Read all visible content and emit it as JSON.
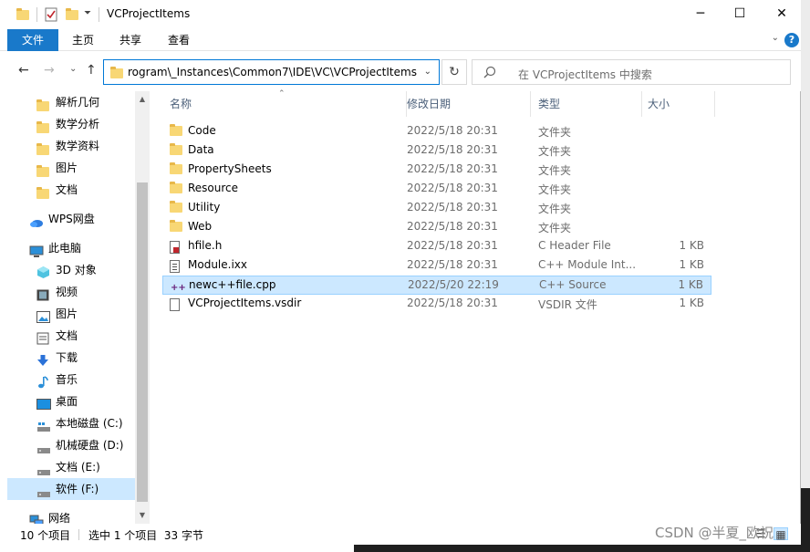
{
  "window": {
    "title": "VCProjectItems",
    "controls": {
      "minimize": "─",
      "maximize": "☐",
      "close": "✕"
    }
  },
  "ribbon": {
    "tabs": [
      "文件",
      "主页",
      "共享",
      "查看"
    ],
    "help": "?",
    "accent_color": "#1979ca"
  },
  "nav": {
    "back": "←",
    "forward": "→",
    "recent": "⌄",
    "up": "↑",
    "address": "rogram\\_Instances\\Common7\\IDE\\VC\\VCProjectItems",
    "refresh": "↻",
    "search_placeholder": "在 VCProjectItems 中搜索"
  },
  "sidebar": {
    "items": [
      {
        "label": "解析几何",
        "icon": "folder-icon",
        "indent": 1
      },
      {
        "label": "数学分析",
        "icon": "folder-icon",
        "indent": 1
      },
      {
        "label": "数学资料",
        "icon": "folder-icon",
        "indent": 1
      },
      {
        "label": "图片",
        "icon": "folder-icon",
        "indent": 1
      },
      {
        "label": "文档",
        "icon": "folder-icon",
        "indent": 1
      },
      {
        "label": "WPS网盘",
        "icon": "cloud-icon",
        "indent": 0
      },
      {
        "label": "此电脑",
        "icon": "computer-icon",
        "indent": 0
      },
      {
        "label": "3D 对象",
        "icon": "cube-icon",
        "indent": 1
      },
      {
        "label": "视频",
        "icon": "video-icon",
        "indent": 1
      },
      {
        "label": "图片",
        "icon": "pictures-icon",
        "indent": 1
      },
      {
        "label": "文档",
        "icon": "documents-icon",
        "indent": 1
      },
      {
        "label": "下载",
        "icon": "download-icon",
        "indent": 1
      },
      {
        "label": "音乐",
        "icon": "music-icon",
        "indent": 1
      },
      {
        "label": "桌面",
        "icon": "desktop-icon",
        "indent": 1
      },
      {
        "label": "本地磁盘 (C:)",
        "icon": "system-drive-icon",
        "indent": 1
      },
      {
        "label": "机械硬盘 (D:)",
        "icon": "drive-icon",
        "indent": 1
      },
      {
        "label": "文档 (E:)",
        "icon": "drive-icon",
        "indent": 1
      },
      {
        "label": "软件 (F:)",
        "icon": "drive-icon",
        "indent": 1,
        "selected": true
      },
      {
        "label": "网络",
        "icon": "network-icon",
        "indent": 0
      }
    ]
  },
  "columns": {
    "name": "名称",
    "date": "修改日期",
    "type": "类型",
    "size": "大小"
  },
  "files": [
    {
      "name": "Code",
      "date": "2022/5/18 20:31",
      "type": "文件夹",
      "size": "",
      "icon": "folder-icon"
    },
    {
      "name": "Data",
      "date": "2022/5/18 20:31",
      "type": "文件夹",
      "size": "",
      "icon": "folder-icon"
    },
    {
      "name": "PropertySheets",
      "date": "2022/5/18 20:31",
      "type": "文件夹",
      "size": "",
      "icon": "folder-icon"
    },
    {
      "name": "Resource",
      "date": "2022/5/18 20:31",
      "type": "文件夹",
      "size": "",
      "icon": "folder-icon"
    },
    {
      "name": "Utility",
      "date": "2022/5/18 20:31",
      "type": "文件夹",
      "size": "",
      "icon": "folder-icon"
    },
    {
      "name": "Web",
      "date": "2022/5/18 20:31",
      "type": "文件夹",
      "size": "",
      "icon": "folder-icon"
    },
    {
      "name": "hfile.h",
      "date": "2022/5/18 20:31",
      "type": "C Header File",
      "size": "1 KB",
      "icon": "header-file-icon"
    },
    {
      "name": "Module.ixx",
      "date": "2022/5/18 20:31",
      "type": "C++ Module Int...",
      "size": "1 KB",
      "icon": "module-file-icon"
    },
    {
      "name": "newc++file.cpp",
      "date": "2022/5/20 22:19",
      "type": "C++ Source",
      "size": "1 KB",
      "icon": "cpp-file-icon",
      "selected": true
    },
    {
      "name": "VCProjectItems.vsdir",
      "date": "2022/5/18 20:31",
      "type": "VSDIR 文件",
      "size": "1 KB",
      "icon": "blank-file-icon"
    }
  ],
  "status": {
    "count": "10 个项目",
    "selection": "选中 1 个项目  33 字节"
  },
  "watermark": "CSDN @半夏_欧祝"
}
